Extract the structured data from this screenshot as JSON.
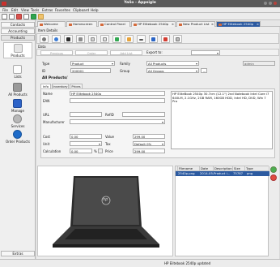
{
  "window": {
    "title": "Yalio - Appsigle"
  },
  "menu": [
    "File",
    "Edit",
    "View",
    "Tools",
    "Extras",
    "Favorites",
    "Clipboard",
    "Help"
  ],
  "sidebar": {
    "headers": [
      "Contacts",
      "Accounting",
      "Products"
    ],
    "items": [
      {
        "label": "Products",
        "icon": "products-icon"
      },
      {
        "label": "Lists",
        "icon": "lists-icon"
      },
      {
        "label": "All Products",
        "icon": "all-products-icon"
      },
      {
        "label": "Manage",
        "icon": "manage-icon"
      },
      {
        "label": "Services",
        "icon": "services-icon"
      },
      {
        "label": "Order Products",
        "icon": "order-products-icon"
      }
    ],
    "footer": "Extras"
  },
  "tabs": [
    "Welcome",
    "Homescreen",
    "Control Panel",
    "HP Elitebook 2540p",
    "New Product List",
    "HP Elitebook 2540p"
  ],
  "content": {
    "item_details": "Item Details",
    "data_label": "Data",
    "nav": {
      "previous": "Previous",
      "order": "Order",
      "add_list": "Add List",
      "export_to": "Export to:"
    },
    "type_label": "Type",
    "type_value": "Product",
    "family_label": "Family",
    "family_value": "All Products",
    "owner_value": "admin",
    "id_label": "ID",
    "id_value": "200001",
    "group_label": "Group",
    "group_value": "All Groups",
    "all_products": "All Products/",
    "inner_tabs": [
      "Info",
      "Inventory",
      "Prices"
    ],
    "name_label": "Name",
    "name_value": "HP Elitebook 2540p",
    "ean_label": "EAN",
    "url_label": "URL",
    "refid_label": "RefID",
    "manufacturer_label": "Manufacturer",
    "description": "HP EliteBook 2540p 30.7cm (12.1\") 2nd Notebook Intel Core i7 640LM, 2.1GHz, 2GB RAM, 160GB HDD, Intel HD, DVD, Win 7 Pro",
    "cost_label": "Cost",
    "cost_value": "0,00",
    "value_label": "Value",
    "value_value": "299,00",
    "unit_label": "Unit",
    "tax_label": "Tax",
    "tax_value": "Default 0%",
    "calc_label": "Calculation",
    "calc_value": "0,00",
    "calc_unit": "%",
    "price_label": "Price",
    "price_value": "299,00",
    "files": {
      "headers": [
        "",
        "Filename",
        "Date",
        "Description",
        "Size",
        "Type"
      ],
      "rows": [
        [
          "",
          "2540p.png",
          "2014-05-20",
          "Product i...",
          "75787",
          "png"
        ]
      ]
    },
    "laptop_brand": "hp"
  },
  "status": {
    "text": "HP Elitebook 2540p   updated"
  }
}
